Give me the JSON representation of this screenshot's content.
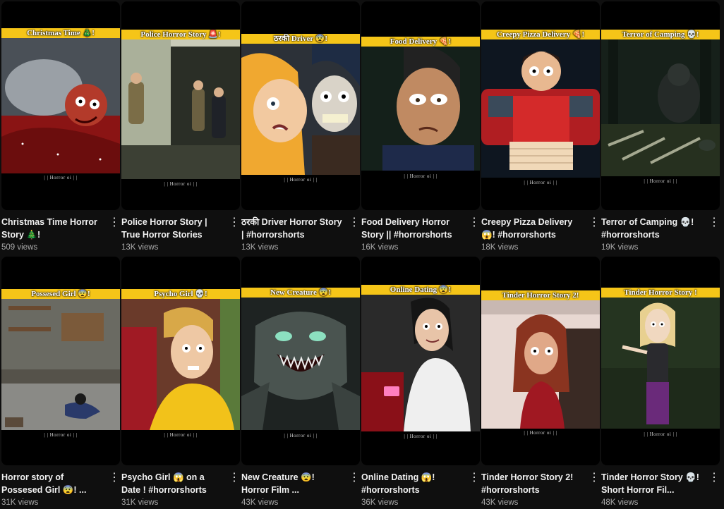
{
  "shorts": [
    {
      "banner": "Christmas Time 🎄!",
      "watermark": "| | Horror oi | |",
      "title": "Christmas Time Horror Story 🎄!",
      "views": "509 views",
      "scene": "christmas"
    },
    {
      "banner": "Police Horror Story 🚨!",
      "watermark": "| | Horror oi | |",
      "title": "Police Horror Story | True Horror Stories",
      "views": "13K views",
      "scene": "police"
    },
    {
      "banner": "ठरकी Driver 😨!",
      "watermark": "| | Horror oi | |",
      "title": "ठरकी Driver Horror Story | #horrorshorts",
      "views": "13K views",
      "scene": "driver"
    },
    {
      "banner": "Food Delivery 🍕!",
      "watermark": "| | Horror oi | |",
      "title": "Food Delivery Horror Story || #horrorshorts",
      "views": "16K views",
      "scene": "food"
    },
    {
      "banner": "Creepy Pizza Delivery 🍕!",
      "watermark": "| | Horror oi | |",
      "title": "Creepy Pizza Delivery 😱! #horrorshorts",
      "views": "18K views",
      "scene": "pizza"
    },
    {
      "banner": "Terror of Camping 💀!",
      "watermark": "| | Horror oi | |",
      "title": "Terror of Camping 💀! #horrorshorts",
      "views": "19K views",
      "scene": "camping"
    },
    {
      "banner": "Possesed Girl 😨!",
      "watermark": "| | Horror oi | |",
      "title": "Horror story of Possesed Girl 😨! ...",
      "views": "31K views",
      "scene": "possessed"
    },
    {
      "banner": "Psycho Girl 💀!",
      "watermark": "| | Horror oi | |",
      "title": "Psycho Girl 😱 on a Date ! #horrorshorts",
      "views": "31K views",
      "scene": "psycho"
    },
    {
      "banner": "New Creature 😨!",
      "watermark": "| | Horror oi | |",
      "title": "New Creature 😨! Horror Film ...",
      "views": "43K views",
      "scene": "creature"
    },
    {
      "banner": "Online Dating 😨!",
      "watermark": "| | Horror oi | |",
      "title": "Online Dating 😱! #horrorshorts",
      "views": "36K views",
      "scene": "dating"
    },
    {
      "banner": "Tinder Horror Story 2!",
      "watermark": "| | Horror oi | |",
      "title": "Tinder Horror Story 2! #horrorshorts",
      "views": "43K views",
      "scene": "tinder2"
    },
    {
      "banner": "Tinder Horror Story !",
      "watermark": "| | Horror oi | |",
      "title": "Tinder Horror Story 💀! Short Horror Fil...",
      "views": "48K views",
      "scene": "tinder"
    }
  ],
  "icons": {
    "menu": "more-vert-icon"
  },
  "colors": {
    "background": "#0f0f0f",
    "banner": "#f5c518",
    "title": "#f1f1f1",
    "views": "#aaaaaa"
  }
}
